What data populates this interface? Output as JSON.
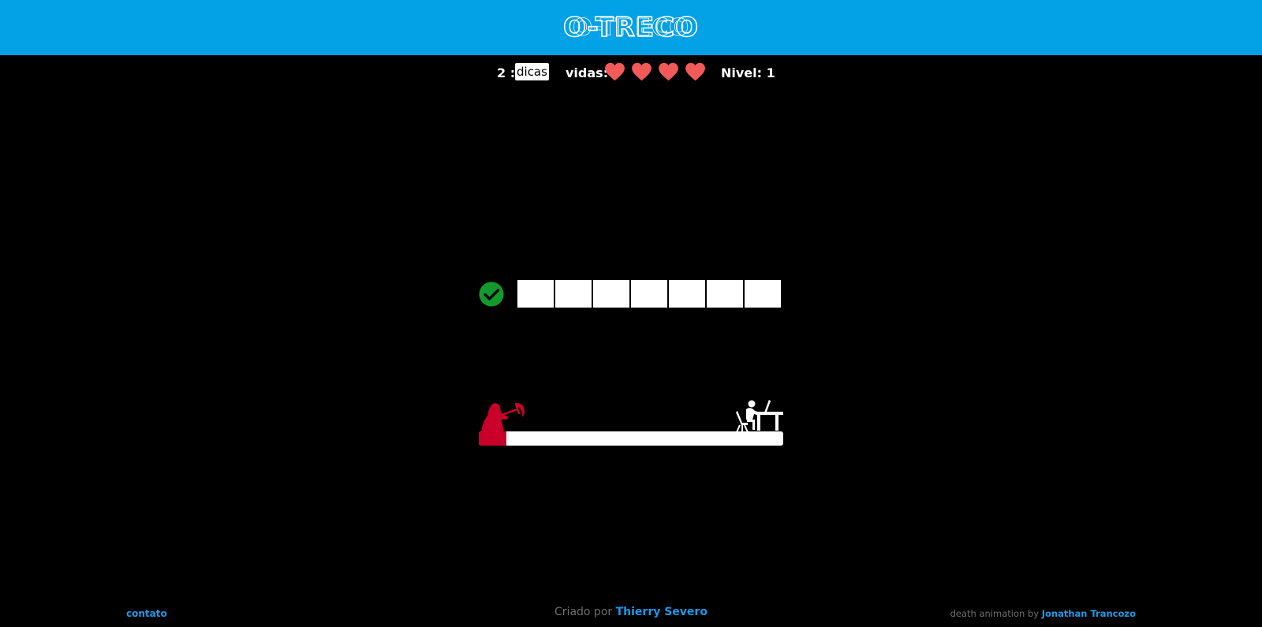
{
  "header": {
    "title": "O-TRECO",
    "background_color": "#03a1e5"
  },
  "status": {
    "hints_remaining": "2 :",
    "hints_button_label": "dicas",
    "lives_label": "vidas:",
    "lives_count": 4,
    "lives_max": 4,
    "heart_color": "#f25a5a",
    "level_label": "Nivel: 1"
  },
  "answer": {
    "submit_icon": "check-circle-icon",
    "submit_color": "#139a2c",
    "letters": [
      "",
      "",
      "",
      "",
      "",
      "",
      ""
    ]
  },
  "death_track": {
    "progress": 0.09,
    "reaper_icon": "grim-reaper-icon",
    "reaper_color": "#c8002a",
    "player_icon": "desk-worker-icon"
  },
  "footer": {
    "contact_label": "contato",
    "created_by_prefix": "Criado por",
    "created_by_name": "Thierry Severo",
    "animation_prefix": "death animation by",
    "animation_author": "Jonathan Trancozo",
    "link_color": "#1a9ae8"
  }
}
